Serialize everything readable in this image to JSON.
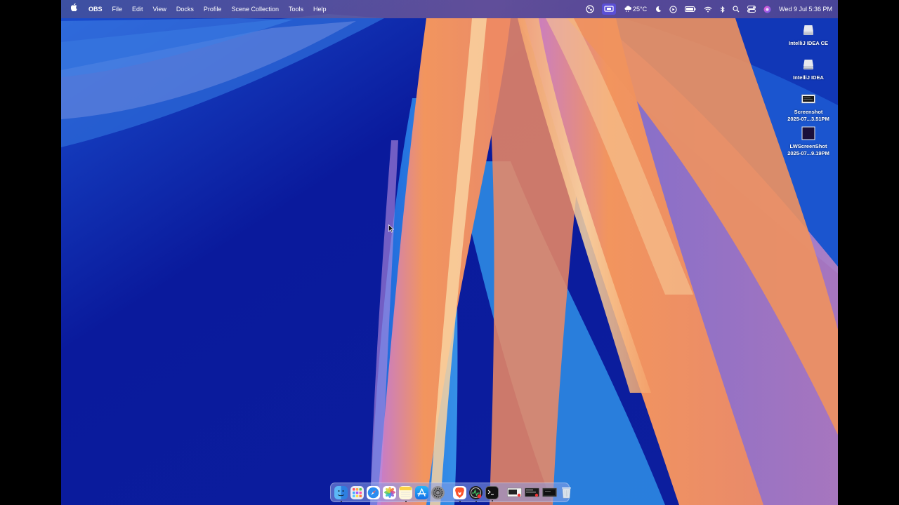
{
  "menubar": {
    "apple_icon": "apple-icon",
    "app_name": "OBS",
    "menus": [
      "File",
      "Edit",
      "View",
      "Docks",
      "Profile",
      "Scene Collection",
      "Tools",
      "Help"
    ],
    "status": {
      "temperature": "25°C",
      "datetime": "Wed 9 Jul  5:36 PM"
    }
  },
  "desktop": {
    "icons": [
      {
        "label": "IntelliJ IDEA CE",
        "icon": "drive-icon"
      },
      {
        "label": "IntelliJ IDEA",
        "icon": "drive-icon"
      },
      {
        "label_line1": "Screenshot",
        "label_line2": "2025-07...3.51PM",
        "icon": "screenshot-icon"
      },
      {
        "label_line1": "LWScreenShot",
        "label_line2": "2025-07...9.19PM",
        "icon": "screenshot-icon"
      }
    ]
  },
  "dock": {
    "apps": [
      "finder",
      "launchpad",
      "safari",
      "photos",
      "notes",
      "app-store",
      "system-settings",
      "brave",
      "activity-monitor",
      "terminal"
    ],
    "recent": [
      "window-thumb-1",
      "window-thumb-2",
      "window-thumb-3"
    ],
    "trash": "trash"
  },
  "colors": {
    "wallpaper_blue": "#0a1a9c",
    "wallpaper_orange": "#f08a55",
    "accent": "#5a4fd6"
  }
}
